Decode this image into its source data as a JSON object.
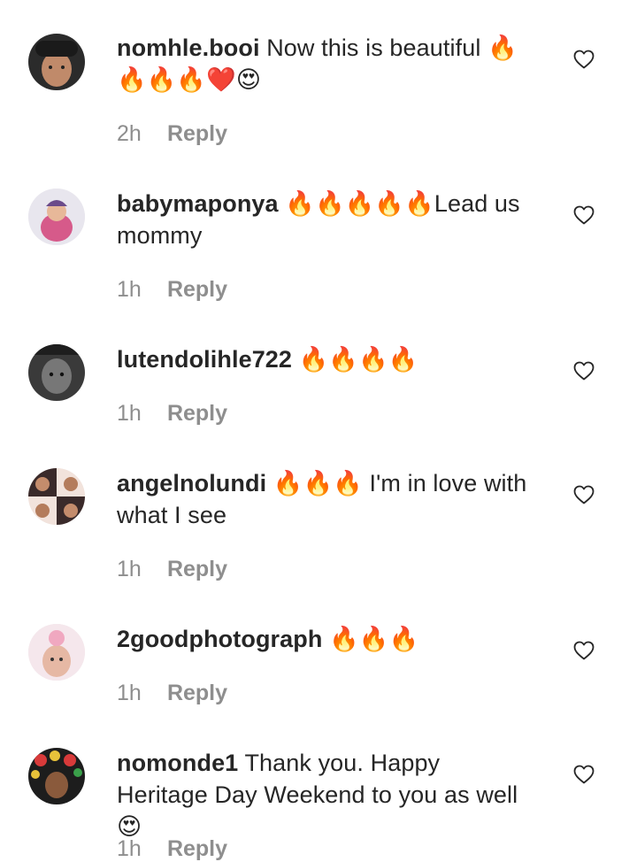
{
  "comments": [
    {
      "username": "nomhle.booi",
      "text": "Now this is beautiful 🔥 🔥🔥🔥❤️😍",
      "time": "2h",
      "reply": "Reply"
    },
    {
      "username": "babymaponya",
      "text": "🔥🔥🔥🔥🔥Lead us mommy",
      "time": "1h",
      "reply": "Reply"
    },
    {
      "username": "lutendolihle722",
      "text": "🔥🔥🔥🔥",
      "time": "1h",
      "reply": "Reply"
    },
    {
      "username": "angelnolundi",
      "text": "🔥🔥🔥 I'm in love with what I see",
      "time": "1h",
      "reply": "Reply"
    },
    {
      "username": "2goodphotograph",
      "text": "🔥🔥🔥",
      "time": "1h",
      "reply": "Reply"
    },
    {
      "username": "nomonde1",
      "text": "Thank you. Happy Heritage Day Weekend to you as well😍",
      "time": "1h",
      "reply": "Reply"
    }
  ],
  "icons": {
    "like": "heart-outline-icon"
  },
  "colors": {
    "text": "#262626",
    "secondary": "#8e8e8e",
    "background": "#ffffff"
  }
}
